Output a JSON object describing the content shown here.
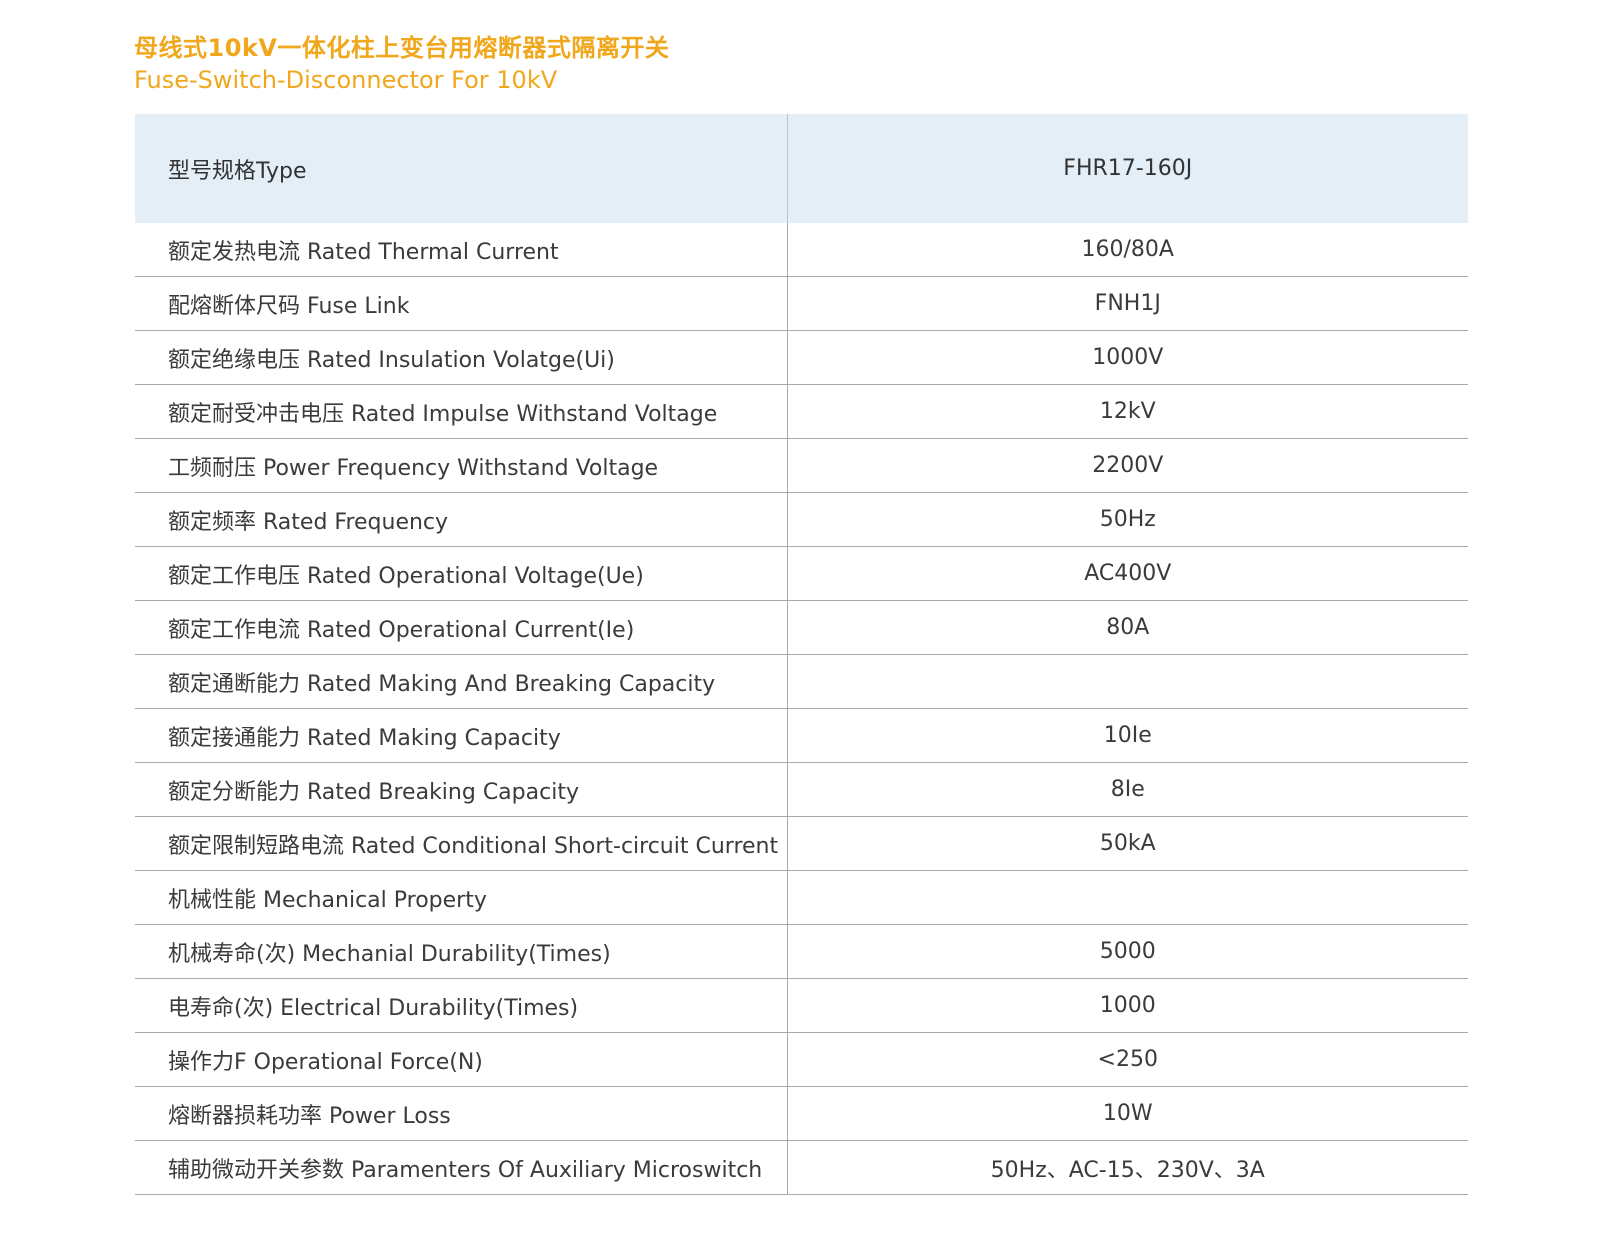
{
  "title_cn": "母线式10kV一体化柱上变台用熔断器式隔离开关",
  "title_en": "Fuse-Switch-Disconnector For 10kV",
  "colors": {
    "title": "#f0a71c",
    "header_bg": "#e3eef6",
    "row_divider": "#a9a9a9"
  },
  "table": {
    "header": {
      "param": "型号规格Type",
      "value": "FHR17-160J"
    },
    "rows": [
      {
        "param": "额定发热电流 Rated Thermal Current",
        "value": "160/80A"
      },
      {
        "param": "配熔断体尺码 Fuse Link",
        "value": "FNH1J"
      },
      {
        "param": "额定绝缘电压 Rated Insulation Volatge(Ui)",
        "value": "1000V"
      },
      {
        "param": "额定耐受冲击电压 Rated Impulse Withstand Voltage",
        "value": "12kV"
      },
      {
        "param": "工频耐压 Power Frequency Withstand Voltage",
        "value": "2200V"
      },
      {
        "param": "额定频率 Rated Frequency",
        "value": "50Hz"
      },
      {
        "param": "额定工作电压 Rated Operational Voltage(Ue)",
        "value": "AC400V"
      },
      {
        "param": "额定工作电流 Rated Operational Current(Ie)",
        "value": "80A"
      },
      {
        "param": "额定通断能力 Rated Making And Breaking Capacity",
        "value": ""
      },
      {
        "param": "额定接通能力 Rated Making Capacity",
        "value": "10Ie"
      },
      {
        "param": "额定分断能力 Rated Breaking Capacity",
        "value": "8Ie"
      },
      {
        "param": "额定限制短路电流 Rated Conditional Short-circuit Current",
        "value": "50kA"
      },
      {
        "param": "机械性能 Mechanical Property",
        "value": ""
      },
      {
        "param": "机械寿命(次) Mechanial Durability(Times)",
        "value": "5000"
      },
      {
        "param": "电寿命(次) Electrical Durability(Times)",
        "value": "1000"
      },
      {
        "param": "操作力F Operational Force(N)",
        "value": "<250"
      },
      {
        "param": "熔断器损耗功率 Power Loss",
        "value": "10W"
      },
      {
        "param": "辅助微动开关参数 Paramenters Of Auxiliary Microswitch",
        "value": "50Hz、AC-15、230V、3A"
      }
    ]
  }
}
